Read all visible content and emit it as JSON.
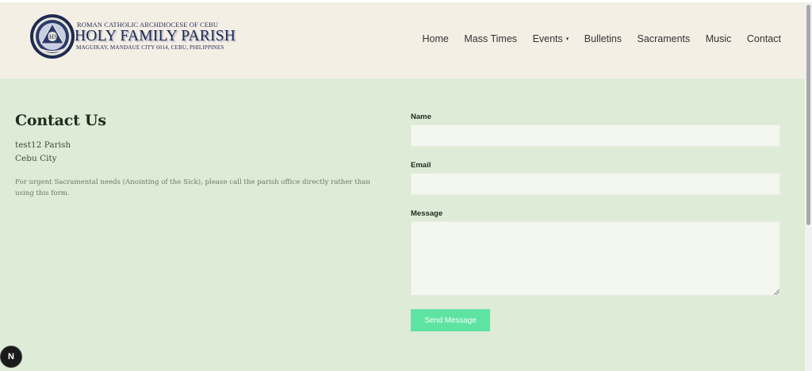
{
  "header": {
    "logo": {
      "top_line": "ROMAN CATHOLIC ARCHDIOCESE OF CEBU",
      "main_line": "HOLY FAMILY PARISH",
      "bottom_line": "MAGUIKAY, MANDAUE CITY 6014, CEBU, PHILIPPINES",
      "seal_icon": "parish-seal-icon"
    },
    "nav": [
      {
        "label": "Home"
      },
      {
        "label": "Mass Times"
      },
      {
        "label": "Events",
        "has_dropdown": true
      },
      {
        "label": "Bulletins"
      },
      {
        "label": "Sacraments"
      },
      {
        "label": "Music"
      },
      {
        "label": "Contact"
      }
    ]
  },
  "contact": {
    "title": "Contact Us",
    "address_line1": "test12 Parish",
    "address_line2": "Cebu City",
    "note": "For urgent Sacramental needs (Anointing of the Sick), please call the parish office directly rather than using this form."
  },
  "form": {
    "name_label": "Name",
    "name_value": "",
    "email_label": "Email",
    "email_value": "",
    "message_label": "Message",
    "message_value": "",
    "submit_label": "Send Message"
  },
  "devtools": {
    "label": "N"
  },
  "colors": {
    "header_bg": "#f4efe5",
    "page_bg": "#deebd6",
    "button_bg": "#5ee3a2",
    "logo_navy": "#1f2a52"
  }
}
